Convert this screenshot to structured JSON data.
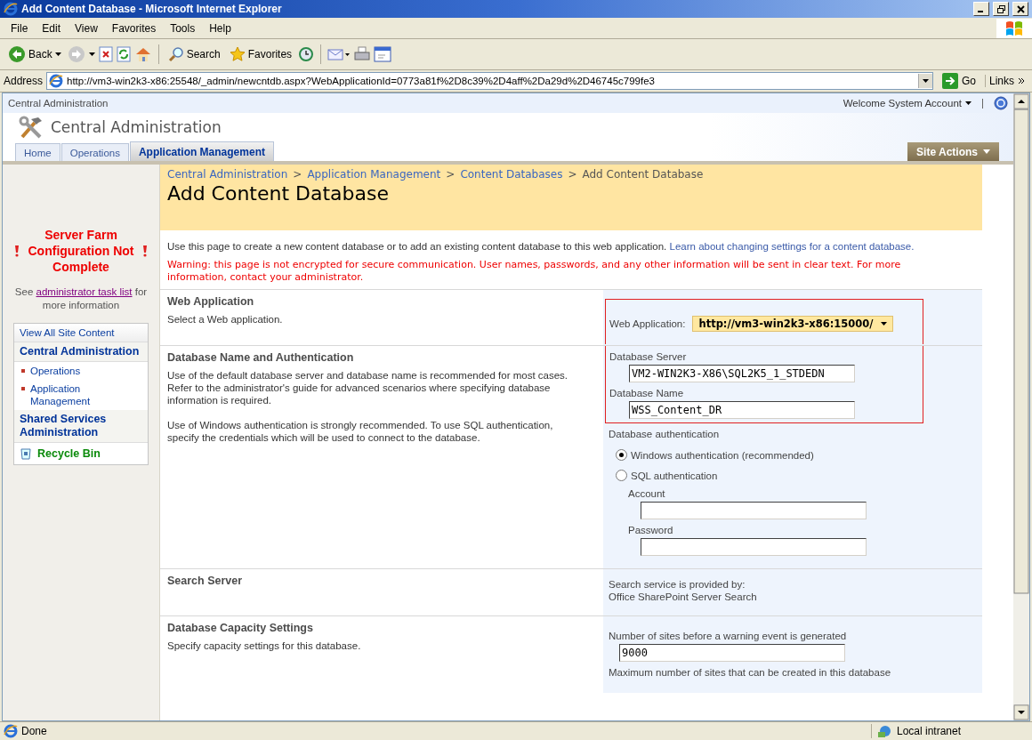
{
  "window": {
    "title": "Add Content Database - Microsoft Internet Explorer"
  },
  "menu": [
    "File",
    "Edit",
    "View",
    "Favorites",
    "Tools",
    "Help"
  ],
  "toolbar": [
    {
      "kind": "back",
      "label": "Back"
    },
    {
      "kind": "forward"
    },
    {
      "kind": "stop"
    },
    {
      "kind": "refresh"
    },
    {
      "kind": "home"
    },
    {
      "kind": "search",
      "label": "Search"
    },
    {
      "kind": "favorites",
      "label": "Favorites"
    },
    {
      "kind": "history"
    },
    {
      "kind": "mail"
    },
    {
      "kind": "print"
    },
    {
      "kind": "edit"
    }
  ],
  "address": {
    "label": "Address",
    "url": "http://vm3-win2k3-x86:25548/_admin/newcntdb.aspx?WebApplicationId=0773a81f%2D8c39%2D4aff%2Da29d%2D46745c799fe3",
    "go": "Go",
    "links": "Links"
  },
  "top_bar": {
    "site": "Central Administration",
    "welcome": "Welcome System Account"
  },
  "header": {
    "title": "Central Administration"
  },
  "tabs": [
    {
      "label": "Home",
      "selected": false
    },
    {
      "label": "Operations",
      "selected": false
    },
    {
      "label": "Application Management",
      "selected": true
    }
  ],
  "site_actions": "Site Actions",
  "breadcrumb": [
    {
      "kind": "link",
      "text": "Central Administration"
    },
    {
      "kind": "separator",
      "text": ">"
    },
    {
      "kind": "link",
      "text": "Application Management"
    },
    {
      "kind": "separator",
      "text": ">"
    },
    {
      "kind": "link",
      "text": "Content Databases"
    },
    {
      "kind": "separator",
      "text": ">"
    },
    {
      "kind": "current",
      "text": "Add Content Database"
    }
  ],
  "page_title": "Add Content Database",
  "intro": {
    "text": "Use this page to create a new content database or to add an existing content database to this web application.",
    "link": "Learn about changing settings for a content database."
  },
  "warning": "Warning: this page is not encrypted for secure communication. User names, passwords, and any other information will be sent in clear text. For more information, contact your administrator.",
  "sidebar": {
    "alert": "Server Farm Configuration Not Complete",
    "see": "See",
    "task_link": "administrator task list",
    "more": "for more information",
    "nav": [
      {
        "kind": "link",
        "label": "View All Site Content"
      },
      {
        "kind": "heading",
        "label": "Central Administration"
      },
      {
        "kind": "item",
        "label": "Operations"
      },
      {
        "kind": "item",
        "label": "Application Management"
      },
      {
        "kind": "heading",
        "label": "Shared Services Administration"
      },
      {
        "kind": "recycle",
        "label": "Recycle Bin"
      }
    ]
  },
  "sections": [
    {
      "heading": "Web Application",
      "description": [
        "Select a Web application."
      ],
      "controls": [
        {
          "kind": "select",
          "label": "Web Application:",
          "value": "http://vm3-win2k3-x86:15000/",
          "highlighted": true
        }
      ]
    },
    {
      "heading": "Database Name and Authentication",
      "description": [
        "Use of the default database server and database name is recommended for most cases. Refer to the administrator's guide for advanced scenarios where specifying database information is required.",
        "Use of Windows authentication is strongly recommended. To use SQL authentication, specify the credentials which will be used to connect to the database."
      ],
      "controls": [
        {
          "kind": "field",
          "label": "Database Server",
          "value": "VM2-WIN2K3-X86\\SQL2K5_1_STDEDN",
          "highlighted": true
        },
        {
          "kind": "field",
          "label": "Database Name",
          "value": "WSS_Content_DR",
          "highlighted": true
        },
        {
          "kind": "label",
          "label": "Database authentication"
        },
        {
          "kind": "radio",
          "label": "Windows authentication (recommended)",
          "selected": true
        },
        {
          "kind": "radio",
          "label": "SQL authentication",
          "selected": false
        },
        {
          "kind": "subfield",
          "label": "Account"
        },
        {
          "kind": "subfield",
          "label": "Password"
        }
      ]
    },
    {
      "heading": "Search Server",
      "controls": [
        {
          "kind": "info",
          "label": "Search service is provided by:"
        },
        {
          "kind": "info",
          "label": "Office SharePoint Server Search"
        }
      ]
    },
    {
      "heading": "Database Capacity Settings",
      "description": [
        "Specify capacity settings for this database."
      ],
      "controls": [
        {
          "kind": "field",
          "label": "Number of sites before a warning event is generated",
          "value": "9000"
        },
        {
          "kind": "label",
          "label": "Maximum number of sites that can be created in this database"
        }
      ]
    }
  ],
  "status": {
    "text": "Done",
    "zone": "Local intranet"
  }
}
